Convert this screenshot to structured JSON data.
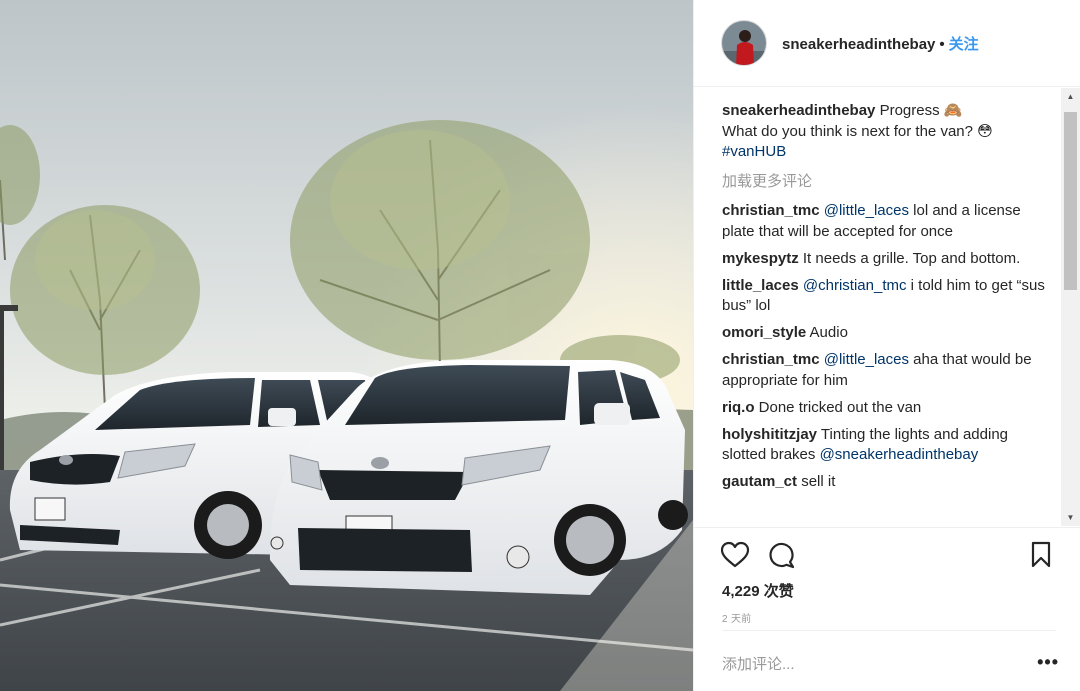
{
  "header": {
    "username": "sneakerheadinthebay",
    "separator": "•",
    "follow_label": "关注"
  },
  "caption": {
    "username": "sneakerheadinthebay",
    "line1": "Progress 🙈",
    "line2": "What do you think is next for the van? 😳",
    "hashtag": "#vanHUB"
  },
  "load_more_label": "加载更多评论",
  "comments": [
    {
      "user": "christian_tmc",
      "mention": "@little_laces",
      "text": " lol and a license plate that will be accepted for once"
    },
    {
      "user": "mykespytz",
      "mention": "",
      "text": " It needs a grille. Top and bottom."
    },
    {
      "user": "little_laces",
      "mention": "@christian_tmc",
      "text": " i told him to get “sus bus” lol"
    },
    {
      "user": "omori_style",
      "mention": "",
      "text": " Audio"
    },
    {
      "user": "christian_tmc",
      "mention": "@little_laces",
      "text": " aha that would be appropriate for him"
    },
    {
      "user": "riq.o",
      "mention": "",
      "text": " Done tricked out the van"
    },
    {
      "user": "holyshititzjay",
      "mention": "",
      "text": " Tinting the lights and adding slotted brakes ",
      "mention_after": "@sneakerheadinthebay"
    },
    {
      "user": "gautam_ct",
      "mention": "",
      "text": " sell it"
    }
  ],
  "likes_label": "4,229 次赞",
  "time_label": "2 天前",
  "add_comment_placeholder": "添加评论...",
  "more_label": "•••",
  "colors": {
    "link": "#003569",
    "follow": "#3897f0",
    "muted": "#999999",
    "text": "#262626"
  },
  "icons": {
    "like": "heart-icon",
    "comment": "speech-bubble-icon",
    "save": "bookmark-icon",
    "scroll_up": "triangle-up-icon",
    "scroll_down": "triangle-down-icon"
  }
}
